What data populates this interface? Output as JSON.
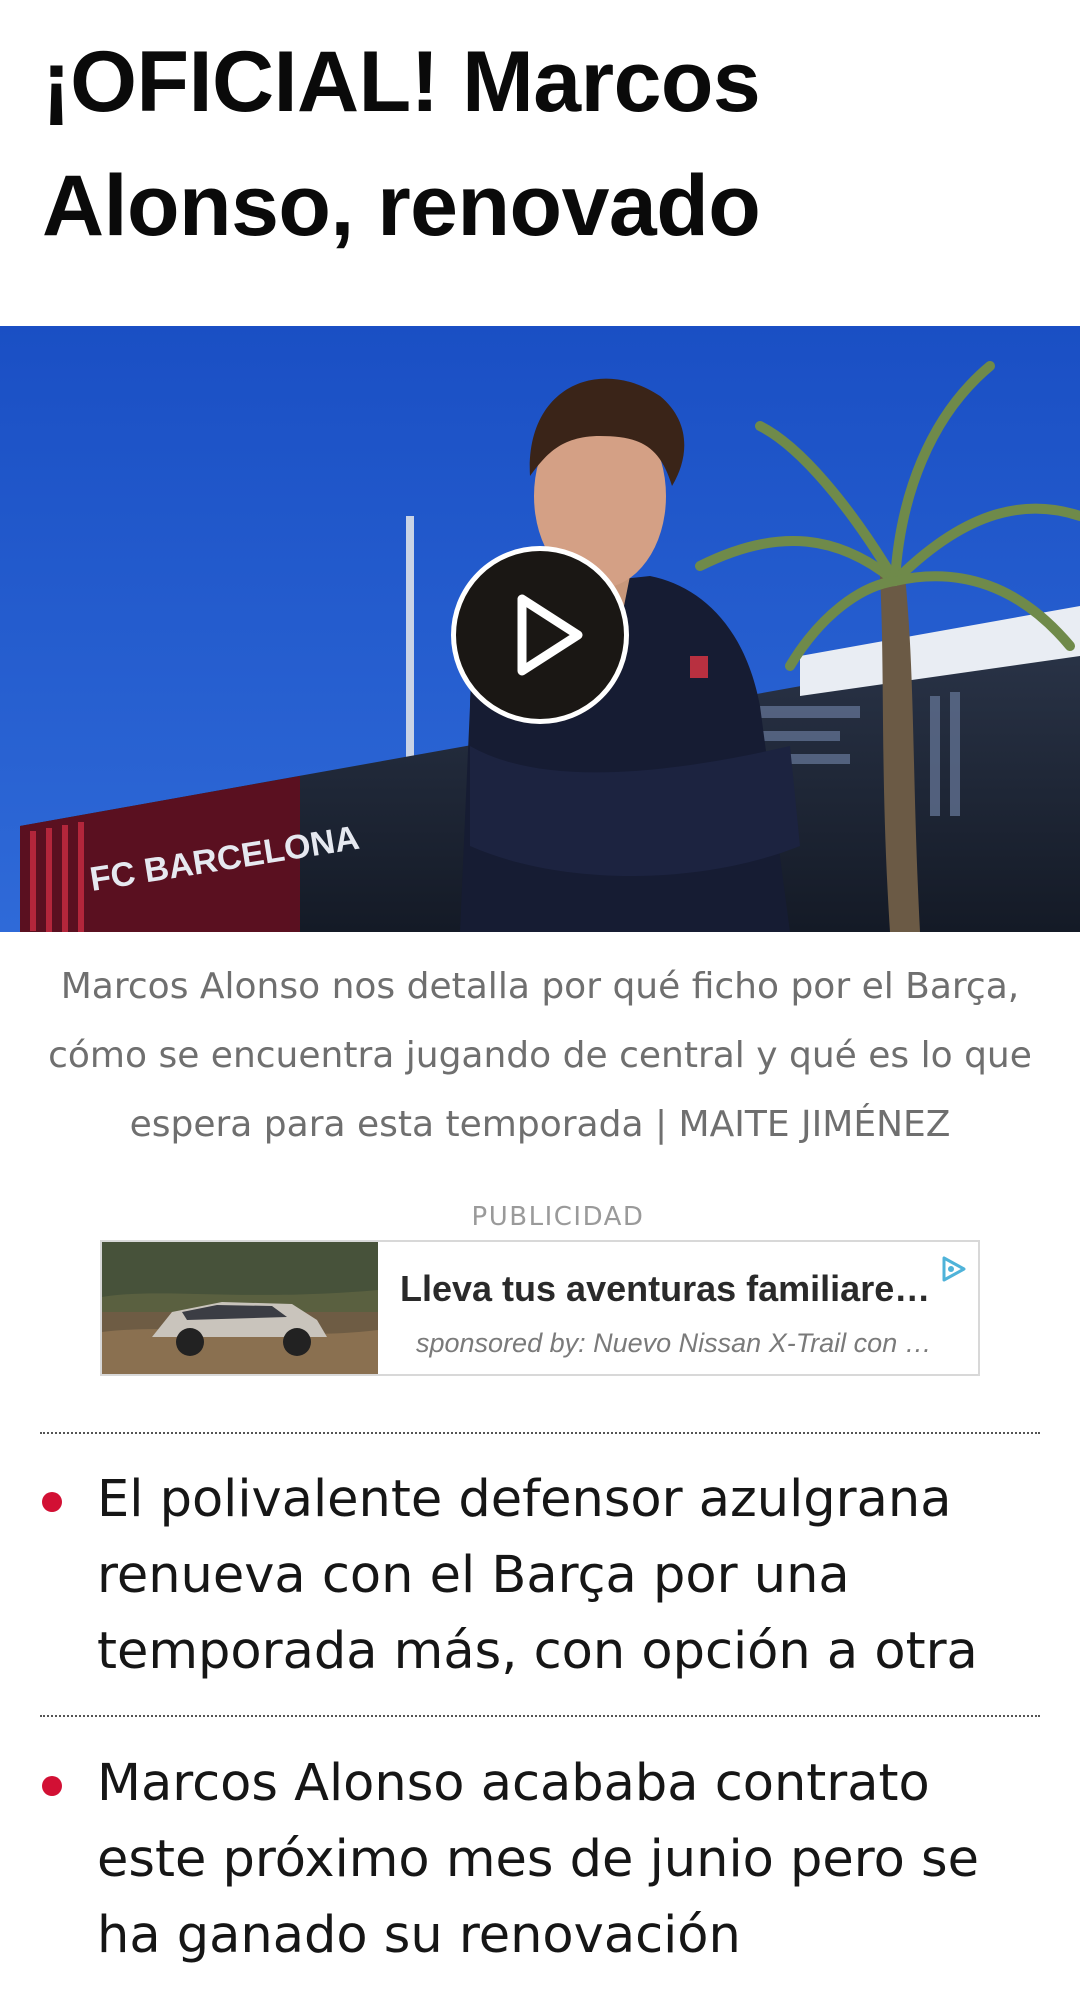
{
  "article": {
    "title": "¡OFICIAL! Marcos Alonso, renovado",
    "hero": {
      "photo_description_icon": "player-photo-icon",
      "video_icon": "play-icon"
    },
    "caption": "Marcos Alonso nos detalla por qué ficho por el Barça, cómo se encuentra jugando de central y qué es lo que espera para esta temporada | MAITE JIMÉNEZ",
    "ad": {
      "label": "PUBLICIDAD",
      "title": "Lleva tus aventuras familiares a otro nivel",
      "sponsor": "sponsored by: Nuevo Nissan X-Trail con tecnología e-POWER",
      "icon": "adchoices-icon"
    },
    "highlights": [
      "El polivalente defensor azulgrana renueva con el Barça por una temporada más, con opción a otra",
      "Marcos Alonso acababa contrato este próximo mes de junio pero se ha ganado su renovación"
    ]
  },
  "colors": {
    "accent": "#d21034",
    "sky": "#1f57c8",
    "text": "#111111",
    "caption": "#6f6f6f"
  }
}
